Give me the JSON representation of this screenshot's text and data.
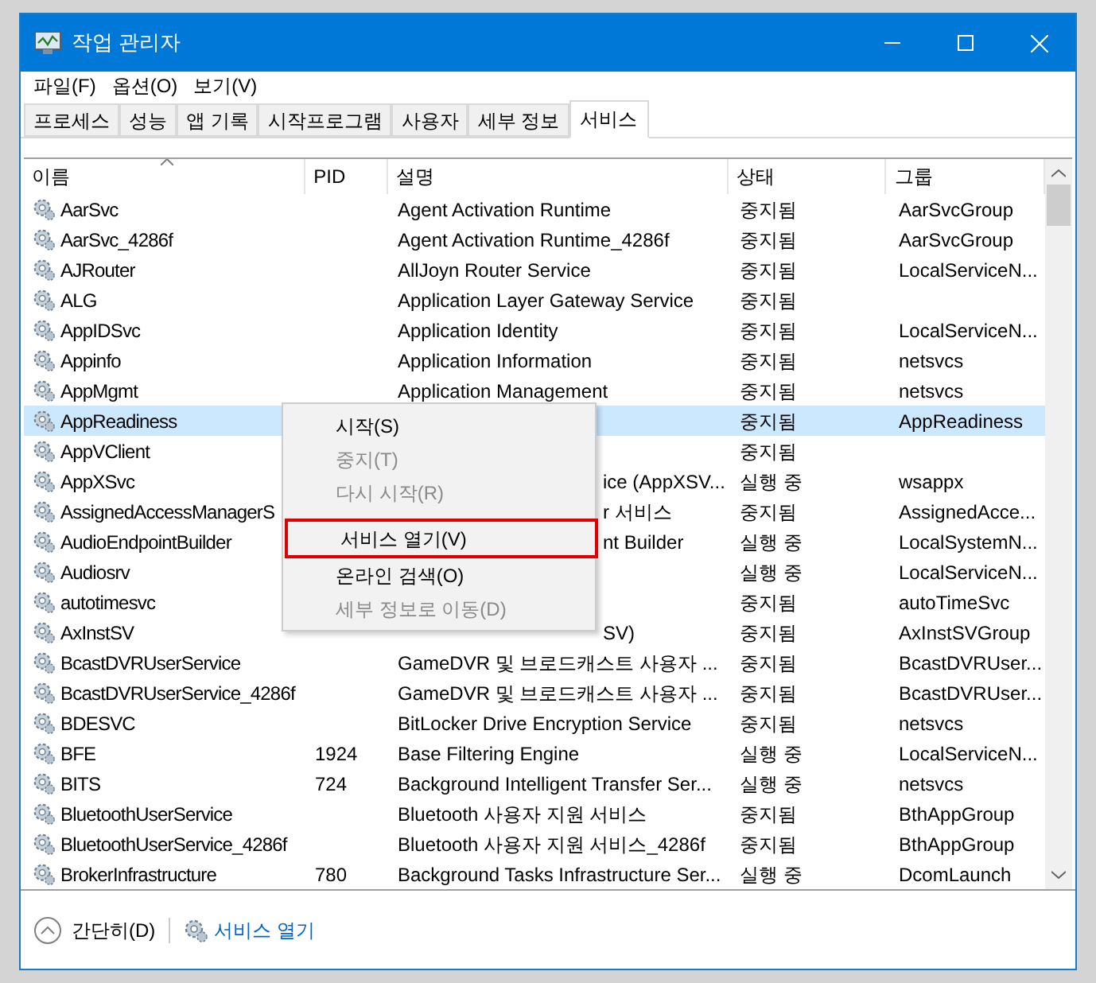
{
  "window": {
    "title": "작업 관리자"
  },
  "menu_bar": [
    "파일(F)",
    "옵션(O)",
    "보기(V)"
  ],
  "tabs": [
    {
      "label": "프로세스",
      "selected": false
    },
    {
      "label": "성능",
      "selected": false
    },
    {
      "label": "앱 기록",
      "selected": false
    },
    {
      "label": "시작프로그램",
      "selected": false
    },
    {
      "label": "사용자",
      "selected": false
    },
    {
      "label": "세부 정보",
      "selected": false
    },
    {
      "label": "서비스",
      "selected": true
    }
  ],
  "table": {
    "columns": [
      "이름",
      "PID",
      "설명",
      "상태",
      "그룹"
    ],
    "rows": [
      {
        "name": "AarSvc",
        "description": "Agent Activation Runtime",
        "status": "중지됨",
        "group": "AarSvcGroup",
        "selected": false
      },
      {
        "name": "AarSvc_4286f",
        "description": "Agent Activation Runtime_4286f",
        "status": "중지됨",
        "group": "AarSvcGroup",
        "selected": false
      },
      {
        "name": "AJRouter",
        "description": "AllJoyn Router Service",
        "status": "중지됨",
        "group": "LocalServiceN...",
        "selected": false
      },
      {
        "name": "ALG",
        "description": "Application Layer Gateway Service",
        "status": "중지됨",
        "selected": false
      },
      {
        "name": "AppIDSvc",
        "description": "Application Identity",
        "status": "중지됨",
        "group": "LocalServiceN...",
        "selected": false
      },
      {
        "name": "Appinfo",
        "description": "Application Information",
        "status": "중지됨",
        "group": "netsvcs",
        "selected": false
      },
      {
        "name": "AppMgmt",
        "description": "Application Management",
        "status": "중지됨",
        "group": "netsvcs",
        "selected": false
      },
      {
        "name": "AppReadiness",
        "status": "중지됨",
        "group": "AppReadiness",
        "selected": true
      },
      {
        "name": "AppVClient",
        "status": "중지됨",
        "selected": false
      },
      {
        "name": "AppXSvc",
        "description": "ice (AppXSV...",
        "status": "실행 중",
        "group": "wsappx",
        "selected": false
      },
      {
        "name": "AssignedAccessManagerS",
        "description": "r 서비스",
        "status": "중지됨",
        "group": "AssignedAcce...",
        "selected": false
      },
      {
        "name": "AudioEndpointBuilder",
        "description": "nt Builder",
        "status": "실행 중",
        "group": "LocalSystemN...",
        "selected": false
      },
      {
        "name": "Audiosrv",
        "status": "실행 중",
        "group": "LocalServiceN...",
        "selected": false
      },
      {
        "name": "autotimesvc",
        "status": "중지됨",
        "group": "autoTimeSvc",
        "selected": false
      },
      {
        "name": "AxInstSV",
        "description": "SV)",
        "status": "중지됨",
        "group": "AxInstSVGroup",
        "selected": false
      },
      {
        "name": "BcastDVRUserService",
        "description": "GameDVR 및 브로드캐스트 사용자 ...",
        "status": "중지됨",
        "group": "BcastDVRUser...",
        "selected": false
      },
      {
        "name": "BcastDVRUserService_4286f",
        "description": "GameDVR 및 브로드캐스트 사용자 ...",
        "status": "중지됨",
        "group": "BcastDVRUser...",
        "selected": false
      },
      {
        "name": "BDESVC",
        "description": "BitLocker Drive Encryption Service",
        "status": "중지됨",
        "group": "netsvcs",
        "selected": false
      },
      {
        "name": "BFE",
        "pid": "1924",
        "description": "Base Filtering Engine",
        "status": "실행 중",
        "group": "LocalServiceN...",
        "selected": false
      },
      {
        "name": "BITS",
        "pid": "724",
        "description": "Background Intelligent Transfer Ser...",
        "status": "실행 중",
        "group": "netsvcs",
        "selected": false
      },
      {
        "name": "BluetoothUserService",
        "description": "Bluetooth 사용자 지원 서비스",
        "status": "중지됨",
        "group": "BthAppGroup",
        "selected": false
      },
      {
        "name": "BluetoothUserService_4286f",
        "description": "Bluetooth 사용자 지원 서비스_4286f",
        "status": "중지됨",
        "group": "BthAppGroup",
        "selected": false
      },
      {
        "name": "BrokerInfrastructure",
        "pid": "780",
        "description": "Background Tasks Infrastructure Ser...",
        "status": "실행 중",
        "group": "DcomLaunch",
        "selected": false
      }
    ]
  },
  "context_menu": [
    {
      "label": "시작(S)",
      "disabled": false,
      "highlighted": false
    },
    {
      "label": "중지(T)",
      "disabled": true,
      "highlighted": false
    },
    {
      "label": "다시 시작(R)",
      "disabled": true,
      "highlighted": false
    },
    {
      "label": "서비스 열기(V)",
      "disabled": false,
      "highlighted": true
    },
    {
      "label": "온라인 검색(O)",
      "disabled": false,
      "highlighted": false
    },
    {
      "label": "세부 정보로 이동(D)",
      "disabled": true,
      "highlighted": false
    }
  ],
  "footer": {
    "collapse": "간단히(D)",
    "open_services": "서비스 열기"
  }
}
